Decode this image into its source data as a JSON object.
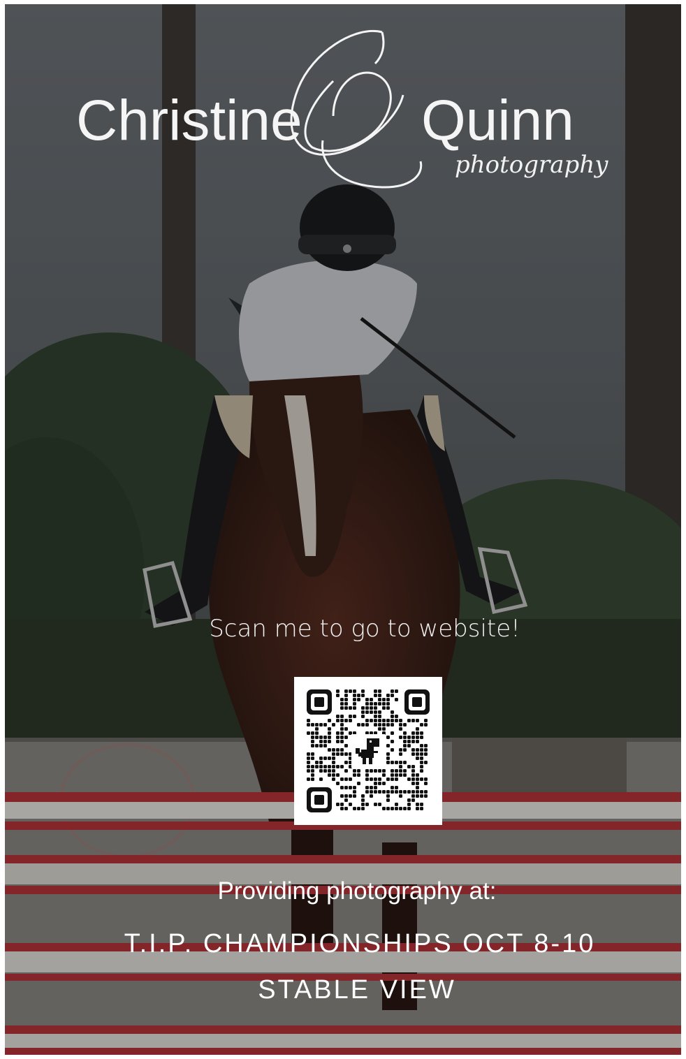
{
  "logo": {
    "name_first": "Christine",
    "name_last": "Quinn",
    "monogram": "CQ",
    "tagline": "photography"
  },
  "qr": {
    "caption": "Scan me to go to website!",
    "center_icon": "dinosaur-icon"
  },
  "event": {
    "lead": "Providing photography at:",
    "name": "T.I.P. CHAMPIONSHIPS OCT 8-10",
    "venue": "STABLE VIEW"
  },
  "colors": {
    "text": "#ffffff",
    "rail_red": "#b8343a",
    "rail_white": "#e9e6e1"
  }
}
